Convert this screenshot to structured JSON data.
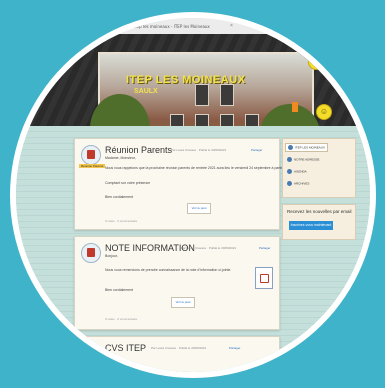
{
  "browser": {
    "tab_title": "itep les moineaux - ITEP les Moineaux",
    "close_glyph": "×"
  },
  "site": {
    "title": "ITEP LES MOINEAUX",
    "subtitle": "SAULX"
  },
  "posts": [
    {
      "title": "Réunion Parents",
      "badge": "Réunion Parents",
      "meta": "Par Laura Cravaux · Publié le 30/09/2021",
      "share_label": "Partager",
      "lines": [
        "Madame, Monsieur,",
        "Nous vous rappelons que la prochaine réunion parents de rentrée 2021 aura lieu le vendredi 24 septembre à partir de 14h00.",
        "Comptant sur votre présence",
        "Bien cordialement"
      ],
      "read_more": "Voir le post",
      "footer": "0 votes · 0 commentaire"
    },
    {
      "title": "NOTE INFORMATION",
      "meta": "Par Laura Cravaux · Publié le 30/09/2021",
      "share_label": "Partager",
      "lines": [
        "Bonjour,",
        "Nous vous remercions de prendre connaissance de la note d'information ci-jointe.",
        "Bien cordialement"
      ],
      "read_more": "Voir le post",
      "footer": "0 votes · 0 commentaire"
    },
    {
      "title": "CVS ITEP",
      "meta": "Par Laura Cravaux · Publié le 30/09/2021",
      "share_label": "Partager"
    }
  ],
  "sidebar": {
    "items": [
      {
        "label": "ITEP LES MOINEAUX"
      },
      {
        "label": "NOTRE ADRESSE"
      },
      {
        "label": "AGENDA"
      },
      {
        "label": "ARCHIVES"
      }
    ],
    "newsletter_label": "Recevez les nouvelles par email",
    "newsletter_button": "Inscrivez-vous maintenant"
  },
  "colors": {
    "background": "#3fb3c9",
    "title_yellow": "#f2e24a",
    "button_blue": "#2b8fd6",
    "bookmark_orange": "#f18a1e"
  },
  "icons": {
    "post_icon": "calendar-icon",
    "attachment_icon": "pdf-file-icon",
    "decor_icon": "smiley-icon"
  }
}
